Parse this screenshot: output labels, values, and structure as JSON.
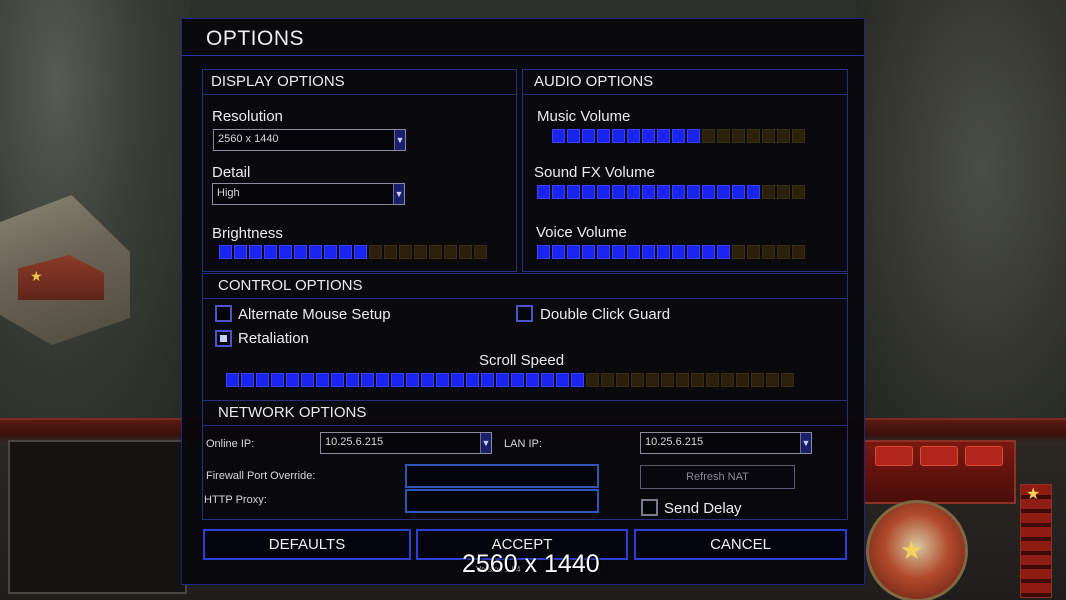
{
  "dialog": {
    "title": "OPTIONS"
  },
  "display": {
    "header": "DISPLAY OPTIONS",
    "resolution_label": "Resolution",
    "resolution_value": "2560 x 1440",
    "detail_label": "Detail",
    "detail_value": "High",
    "brightness_label": "Brightness",
    "brightness_level": 10,
    "brightness_max": 18
  },
  "audio": {
    "header": "AUDIO OPTIONS",
    "music_label": "Music Volume",
    "music_level": 10,
    "music_max": 17,
    "sfx_label": "Sound FX Volume",
    "sfx_level": 15,
    "sfx_max": 18,
    "voice_label": "Voice Volume",
    "voice_level": 13,
    "voice_max": 18
  },
  "control": {
    "header": "CONTROL OPTIONS",
    "alt_mouse_label": "Alternate Mouse Setup",
    "alt_mouse_checked": false,
    "double_click_label": "Double Click Guard",
    "double_click_checked": false,
    "retaliation_label": "Retaliation",
    "retaliation_checked": true,
    "scroll_speed_label": "Scroll Speed",
    "scroll_level": 24,
    "scroll_max": 38
  },
  "network": {
    "header": "NETWORK OPTIONS",
    "online_ip_label": "Online IP:",
    "online_ip_value": "10.25.6.215",
    "lan_ip_label": "LAN IP:",
    "lan_ip_value": "10.25.6.215",
    "firewall_label": "Firewall Port Override:",
    "firewall_value": "",
    "proxy_label": "HTTP Proxy:",
    "proxy_value": "",
    "refresh_nat_label": "Refresh NAT",
    "send_delay_label": "Send Delay",
    "send_delay_checked": false
  },
  "buttons": {
    "defaults": "DEFAULTS",
    "accept": "ACCEPT",
    "cancel": "CANCEL"
  },
  "version_text": "Version 1.04",
  "overlay_resolution": "2560 x 1440",
  "colors": {
    "accent": "#1a23f0",
    "segment_off": "#2a200c",
    "border": "#27307f"
  }
}
